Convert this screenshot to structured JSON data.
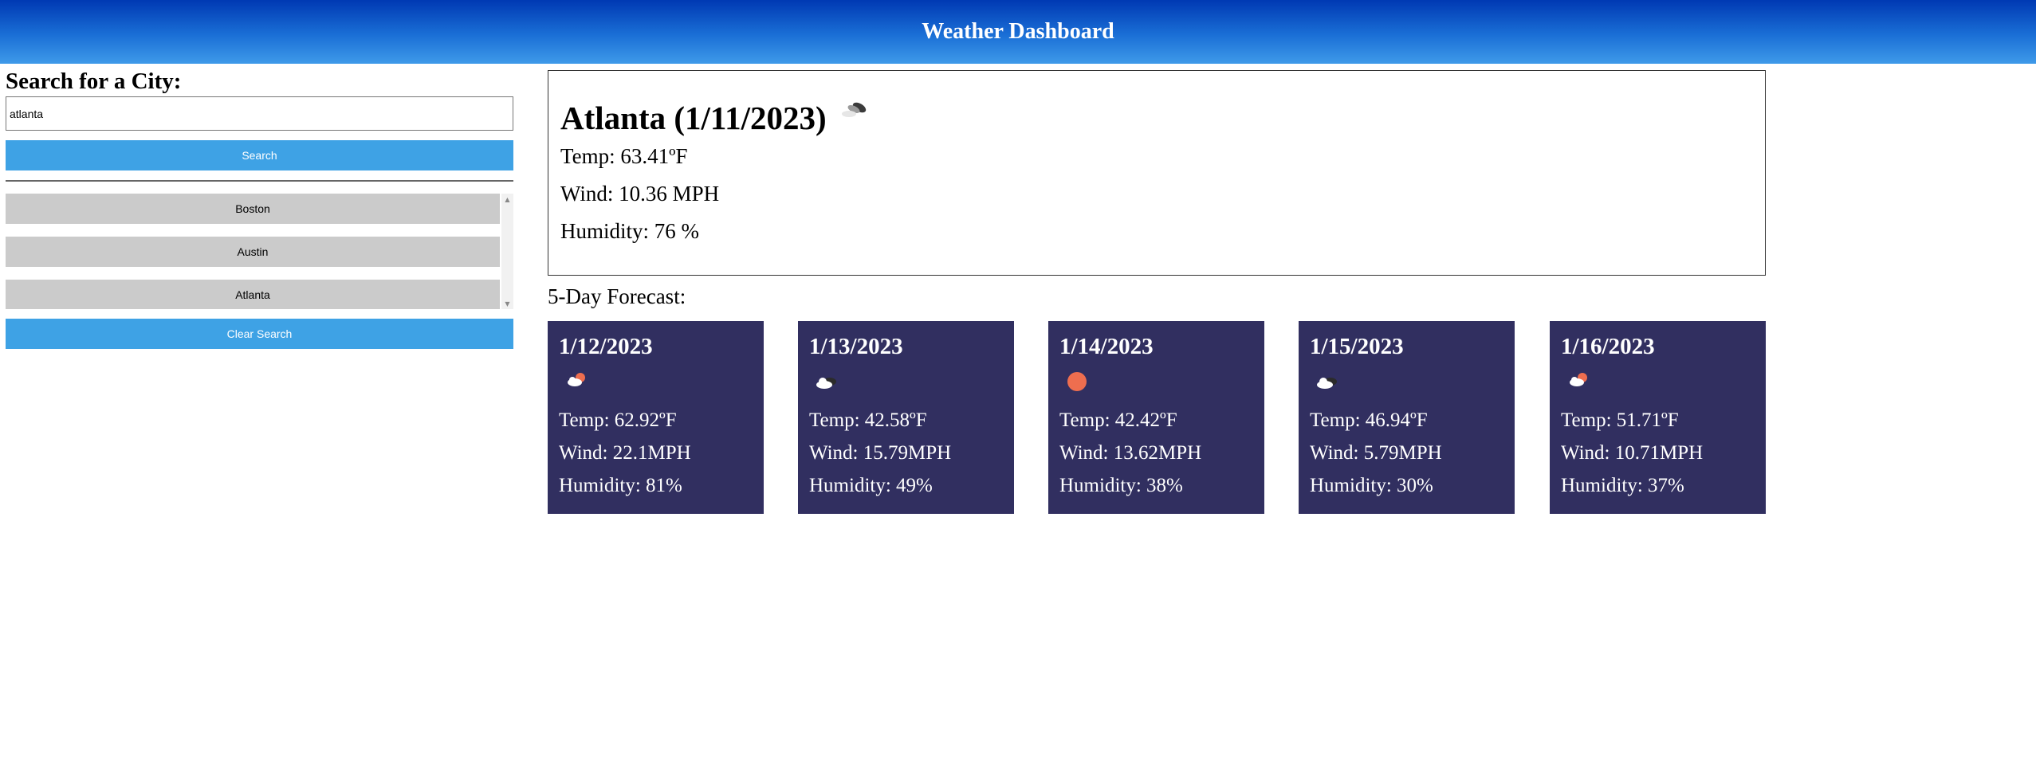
{
  "header": {
    "title": "Weather Dashboard"
  },
  "search": {
    "heading": "Search for a City:",
    "input_value": "atlanta",
    "search_label": "Search",
    "clear_label": "Clear Search",
    "history": [
      "Boston",
      "Austin",
      "Atlanta"
    ]
  },
  "current": {
    "title": "Atlanta (1/11/2023)",
    "icon": "broken-clouds-icon",
    "temp": "Temp: 63.41ºF",
    "wind": "Wind: 10.36 MPH",
    "humidity": "Humidity: 76 %"
  },
  "forecast": {
    "heading": "5-Day Forecast:",
    "days": [
      {
        "date": "1/12/2023",
        "icon": "few-clouds-day-icon",
        "temp": "Temp: 62.92ºF",
        "wind": "Wind: 22.1MPH",
        "humidity": "Humidity: 81%"
      },
      {
        "date": "1/13/2023",
        "icon": "scattered-clouds-icon",
        "temp": "Temp: 42.58ºF",
        "wind": "Wind: 15.79MPH",
        "humidity": "Humidity: 49%"
      },
      {
        "date": "1/14/2023",
        "icon": "clear-sky-icon",
        "temp": "Temp: 42.42ºF",
        "wind": "Wind: 13.62MPH",
        "humidity": "Humidity: 38%"
      },
      {
        "date": "1/15/2023",
        "icon": "scattered-clouds-icon",
        "temp": "Temp: 46.94ºF",
        "wind": "Wind: 5.79MPH",
        "humidity": "Humidity: 30%"
      },
      {
        "date": "1/16/2023",
        "icon": "few-clouds-day-icon",
        "temp": "Temp: 51.71ºF",
        "wind": "Wind: 10.71MPH",
        "humidity": "Humidity: 37%"
      }
    ]
  },
  "colors": {
    "header_start": "#0039b3",
    "header_end": "#3e9ae9",
    "button_blue": "#3ea2e5",
    "history_gray": "#cbcbcb",
    "card_bg": "#312f60",
    "sun": "#ee6e4f"
  }
}
